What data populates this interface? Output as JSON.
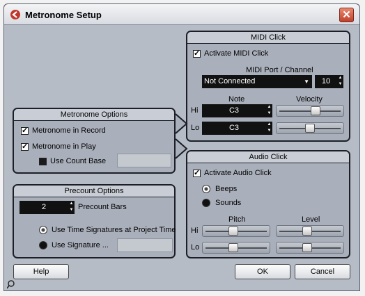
{
  "window": {
    "title": "Metronome Setup",
    "close_glyph": "✕"
  },
  "metronome_options": {
    "title": "Metronome Options",
    "in_record": "Metronome in Record",
    "in_play": "Metronome in Play",
    "count_base": "Use Count Base"
  },
  "precount_options": {
    "title": "Precount Options",
    "bars_value": "2",
    "bars_label": "Precount Bars",
    "use_time_sig": "Use Time Signatures at Project Time",
    "use_signature": "Use Signature ..."
  },
  "midi_click": {
    "title": "MIDI Click",
    "activate": "Activate MIDI Click",
    "port_label": "MIDI Port / Channel",
    "port_value": "Not Connected",
    "channel_value": "10",
    "note_header": "Note",
    "velocity_header": "Velocity",
    "hi_label": "Hi",
    "lo_label": "Lo",
    "hi_note": "C3",
    "lo_note": "C3",
    "hi_velocity_fraction": 0.6,
    "lo_velocity_fraction": 0.5
  },
  "audio_click": {
    "title": "Audio Click",
    "activate": "Activate Audio Click",
    "beeps": "Beeps",
    "sounds": "Sounds",
    "pitch_header": "Pitch",
    "level_header": "Level",
    "hi_label": "Hi",
    "lo_label": "Lo",
    "hi_pitch_fraction": 0.45,
    "lo_pitch_fraction": 0.45,
    "hi_level_fraction": 0.45,
    "lo_level_fraction": 0.45
  },
  "buttons": {
    "help": "Help",
    "ok": "OK",
    "cancel": "Cancel"
  },
  "icons": {
    "spin_up": "▲",
    "spin_down": "▼"
  }
}
